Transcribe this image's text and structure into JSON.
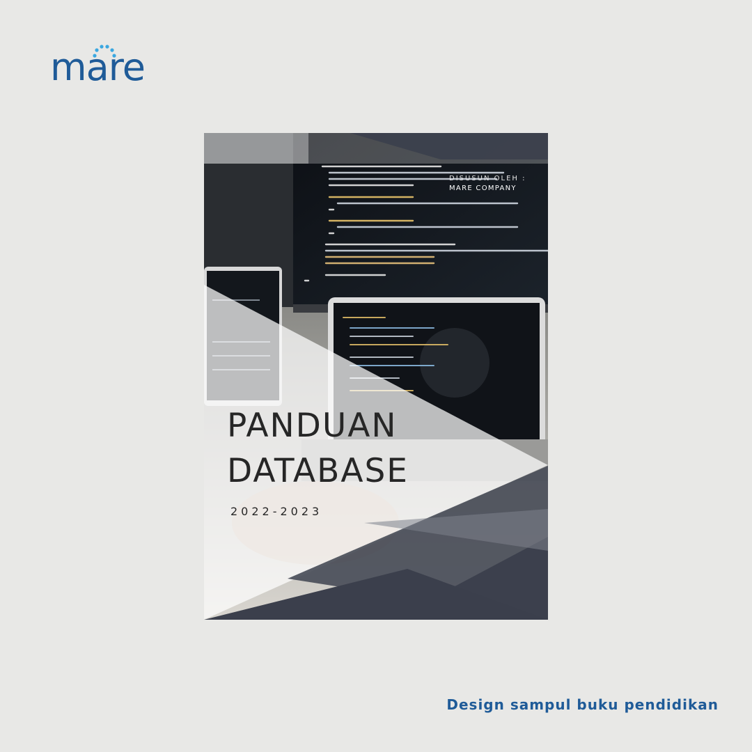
{
  "brand": {
    "logo_text": "mare",
    "logo_color": "#1f5b98"
  },
  "cover": {
    "author_label": "DISUSUN OLEH :",
    "author_name": "MARE COMPANY",
    "title_line_1": "PANDUAN",
    "title_line_2": "DATABASE",
    "year": "2022-2023",
    "colors": {
      "dark_slate": "#3b3f4c",
      "photo_dark": "#111418",
      "text": "#262626"
    }
  },
  "caption": "Design sampul buku pendidikan"
}
